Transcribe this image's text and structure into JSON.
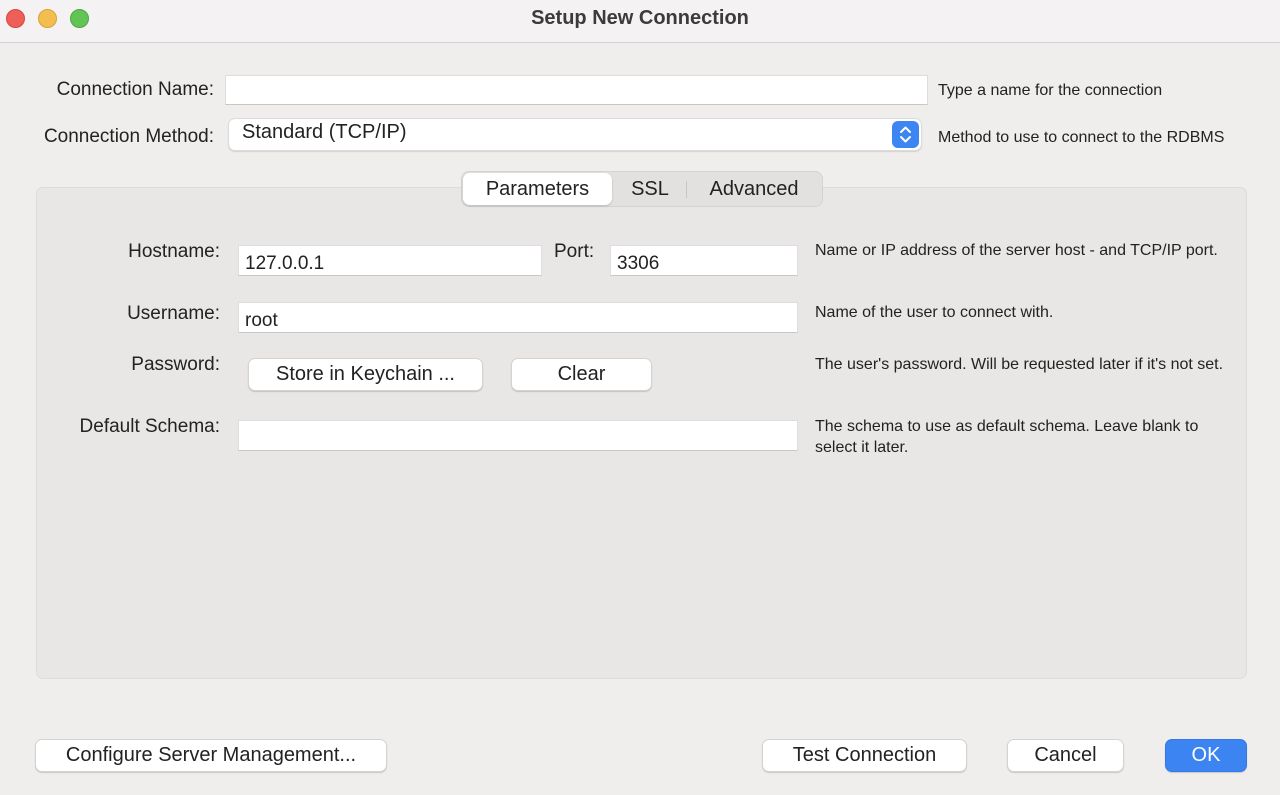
{
  "window": {
    "title": "Setup New Connection"
  },
  "connection": {
    "name_label": "Connection Name:",
    "name_value": "",
    "name_hint": "Type a name for the connection",
    "method_label": "Connection Method:",
    "method_value": "Standard (TCP/IP)",
    "method_hint": "Method to use to connect to the RDBMS"
  },
  "tabs": [
    {
      "label": "Parameters",
      "active": true
    },
    {
      "label": "SSL",
      "active": false
    },
    {
      "label": "Advanced",
      "active": false
    }
  ],
  "parameters": {
    "hostname_label": "Hostname:",
    "hostname_value": "127.0.0.1",
    "port_label": "Port:",
    "port_value": "3306",
    "host_hint": "Name or IP address of the server host - and TCP/IP port.",
    "username_label": "Username:",
    "username_value": "root",
    "username_hint": "Name of the user to connect with.",
    "password_label": "Password:",
    "store_keychain_label": "Store in Keychain ...",
    "clear_label": "Clear",
    "password_hint": "The user's password. Will be requested later if it's not set.",
    "schema_label": "Default Schema:",
    "schema_value": "",
    "schema_hint": "The schema to use as default schema. Leave blank to select it later."
  },
  "footer": {
    "configure_label": "Configure Server Management...",
    "test_label": "Test Connection",
    "cancel_label": "Cancel",
    "ok_label": "OK"
  },
  "colors": {
    "accent": "#3b84f1",
    "close": "#ee5f57",
    "minimize": "#f4bd4f",
    "maximize": "#61c455"
  }
}
